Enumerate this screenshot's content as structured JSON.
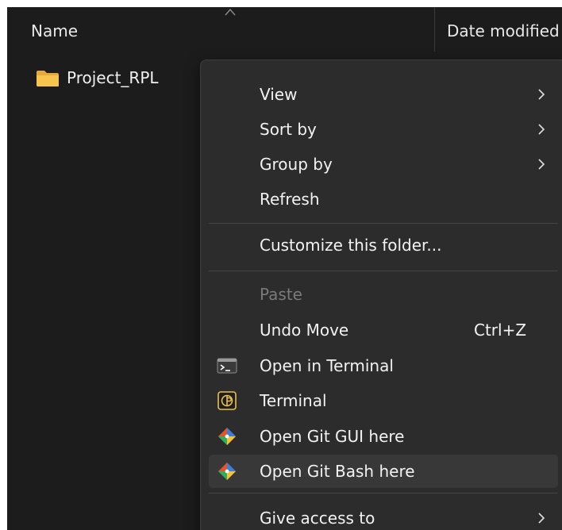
{
  "header": {
    "col_name": "Name",
    "col_date": "Date modified"
  },
  "files": [
    {
      "name": "Project_RPL",
      "icon": "folder-icon"
    }
  ],
  "menu": {
    "items": [
      {
        "label": "View",
        "submenu": true
      },
      {
        "label": "Sort by",
        "submenu": true
      },
      {
        "label": "Group by",
        "submenu": true
      },
      {
        "label": "Refresh"
      },
      {
        "label": "Customize this folder..."
      },
      {
        "label": "Paste",
        "disabled": true
      },
      {
        "label": "Undo Move",
        "shortcut": "Ctrl+Z"
      },
      {
        "label": "Open in Terminal",
        "icon": "terminal-icon"
      },
      {
        "label": "Terminal",
        "icon": "terminal-app-icon"
      },
      {
        "label": "Open Git GUI here",
        "icon": "git-gui-icon"
      },
      {
        "label": "Open Git Bash here",
        "icon": "git-bash-icon",
        "hovered": true
      },
      {
        "label": "Give access to",
        "submenu": true
      }
    ]
  },
  "colors": {
    "explorer_bg": "#1c1c1c",
    "menu_bg": "#2c2c2c",
    "hover_bg": "#383838",
    "folder": "#f5c04a",
    "terminal_app": "#e8c04c"
  }
}
